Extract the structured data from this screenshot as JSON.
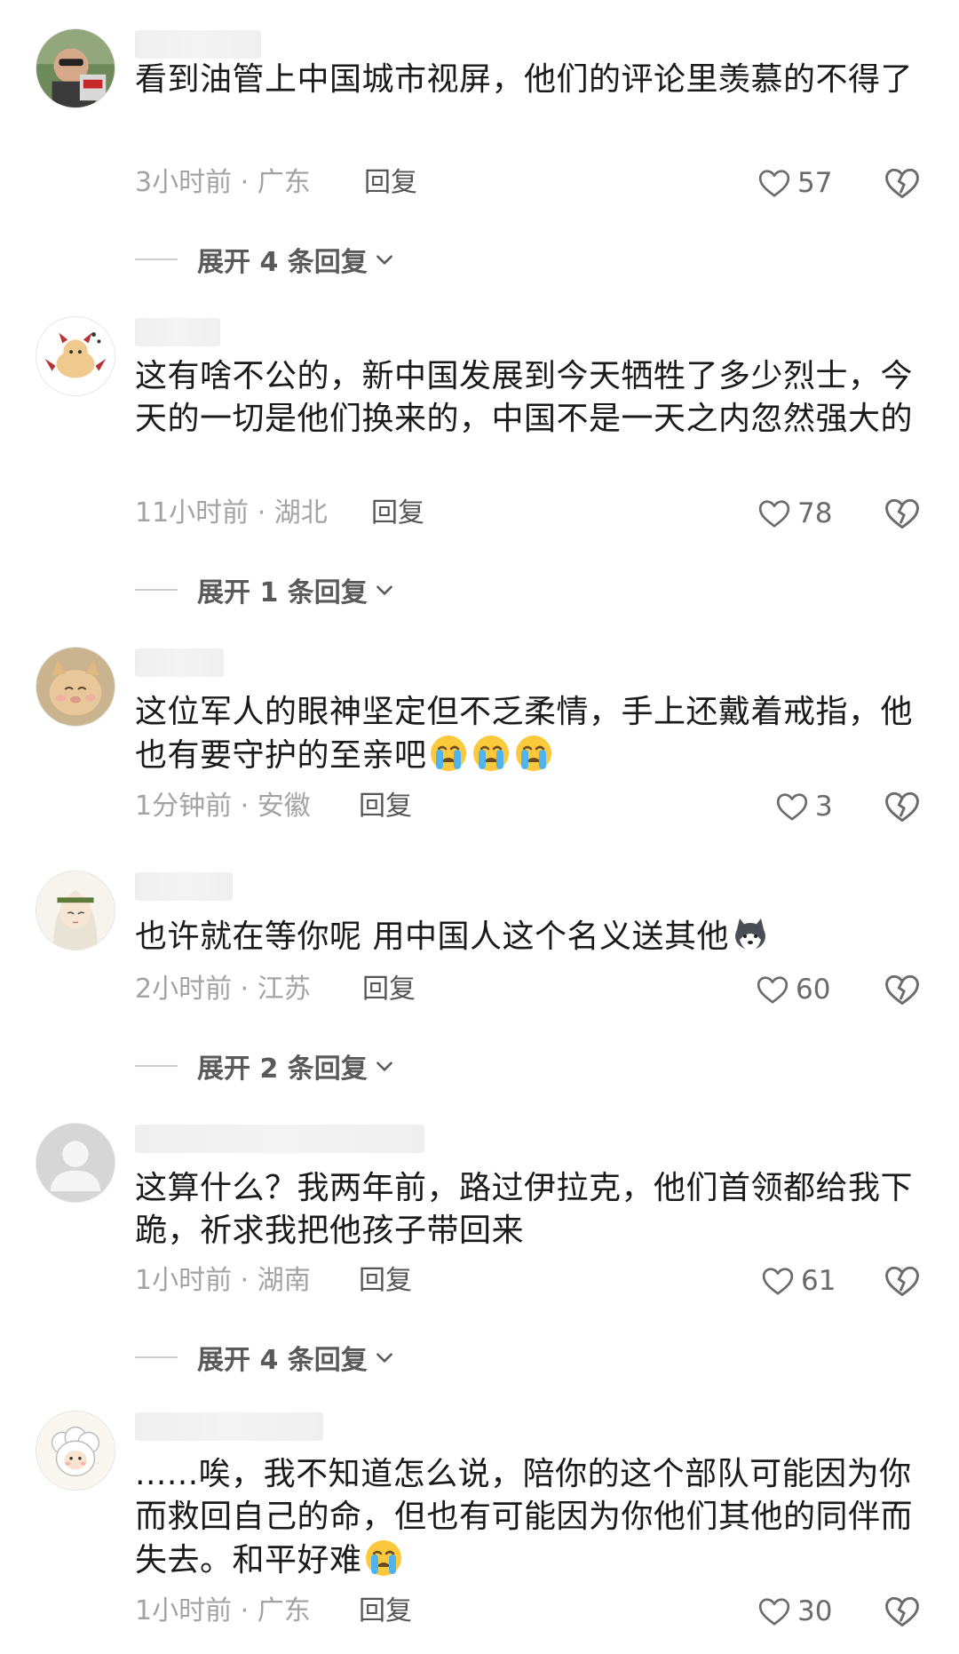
{
  "comments": [
    {
      "text": "看到油管上中国城市视屏，他们的评论里羡慕的不得了",
      "meta": "3小时前 · 广东",
      "reply": "回复",
      "likes": "57",
      "expand": "展开 4 条回复"
    },
    {
      "text": "这有啥不公的，新中国发展到今天牺牲了多少烈士，今天的一切是他们换来的，中国不是一天之内忽然强大的",
      "meta": "11小时前 · 湖北",
      "reply": "回复",
      "likes": "78",
      "expand": "展开 1 条回复"
    },
    {
      "text": "这位军人的眼神坚定但不乏柔情，手上还戴着戒指，他也有要守护的至亲吧",
      "meta": "1分钟前 · 安徽",
      "reply": "回复",
      "likes": "3"
    },
    {
      "text": "也许就在等你呢 用中国人这个名义送其他",
      "meta": "2小时前 · 江苏",
      "reply": "回复",
      "likes": "60",
      "expand": "展开 2 条回复"
    },
    {
      "text": "这算什么？我两年前，路过伊拉克，他们首领都给我下跪，祈求我把他孩子带回来",
      "meta": "1小时前 · 湖南",
      "reply": "回复",
      "likes": "61",
      "expand": "展开 4 条回复"
    },
    {
      "text": "......唉，我不知道怎么说，陪你的这个部队可能因为你而救回自己的命，但也有可能因为你他们其他的同伴而失去。和平好难",
      "meta": "1小时前 · 广东",
      "reply": "回复",
      "likes": "30"
    }
  ],
  "icons": {
    "like": "heart-outline-icon",
    "dislike": "broken-heart-icon",
    "expand": "chevron-down-icon",
    "emoji_cry": "loudly-crying-face-icon",
    "emoji_dog": "husky-face-icon"
  },
  "colors": {
    "text": "#1a1a1a",
    "meta": "#a3a3a3",
    "icon": "#6b6b6b"
  }
}
